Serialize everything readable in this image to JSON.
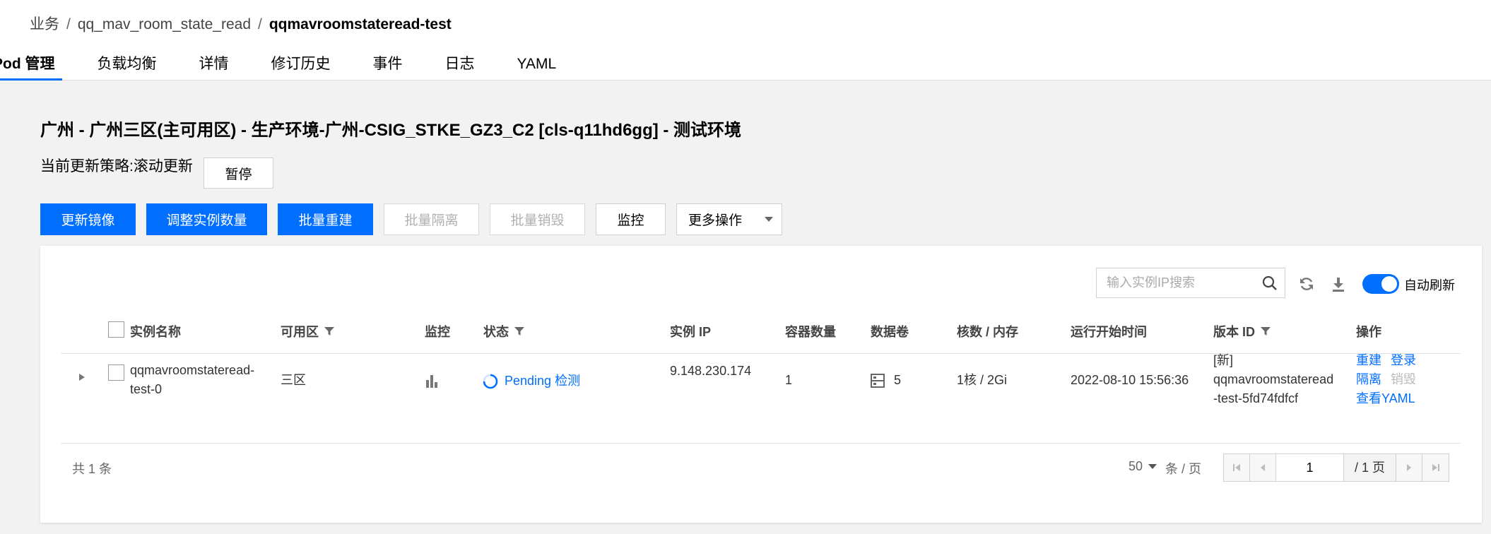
{
  "breadcrumb": {
    "item1": "业务",
    "item2": "qq_mav_room_state_read",
    "current": "qqmavroomstateread-test",
    "sep": "/"
  },
  "tabs": [
    {
      "label": "Pod 管理",
      "active": true
    },
    {
      "label": "负载均衡"
    },
    {
      "label": "详情"
    },
    {
      "label": "修订历史"
    },
    {
      "label": "事件"
    },
    {
      "label": "日志"
    },
    {
      "label": "YAML"
    }
  ],
  "cluster_title": "广州 - 广州三区(主可用区) - 生产环境-广州-CSIG_STKE_GZ3_C2 [cls-q11hd6gg] - 测试环境",
  "strategy": {
    "label": "当前更新策略:滚动更新",
    "pause_button": "暂停"
  },
  "actions": {
    "update_image": "更新镜像",
    "adjust_instances": "调整实例数量",
    "batch_rebuild": "批量重建",
    "batch_isolate": "批量隔离",
    "batch_destroy": "批量销毁",
    "monitor": "监控",
    "more": "更多操作"
  },
  "search": {
    "placeholder": "输入实例IP搜索"
  },
  "auto_refresh": {
    "label": "自动刷新",
    "on": true
  },
  "table": {
    "headers": {
      "name": "实例名称",
      "zone": "可用区",
      "monitor": "监控",
      "status": "状态",
      "ip": "实例 IP",
      "containers": "容器数量",
      "volumes": "数据卷",
      "cpu_mem": "核数 / 内存",
      "start_time": "运行开始时间",
      "version": "版本 ID",
      "ops": "操作"
    },
    "rows": [
      {
        "name_line1": "qqmavroomstateread-",
        "name_line2": "test-0",
        "zone": "三区",
        "status": "Pending",
        "status_action": "检测",
        "ip": "9.148.230.174",
        "containers": "1",
        "volumes": "5",
        "cpu_mem": "1核 / 2Gi",
        "start_time": "2022-08-10 15:56:36",
        "version_line1": "[新]",
        "version_line2": "qqmavroomstateread",
        "version_line3": "-test-5fd74fdfcf",
        "op_rebuild": "重建",
        "op_login": "登录",
        "op_isolate": "隔离",
        "op_destroy": "销毁",
        "op_yaml": "查看YAML"
      }
    ]
  },
  "footer": {
    "total": "共 1 条",
    "page_size": "50",
    "page_size_unit": "条 / 页",
    "current_page": "1",
    "total_pages": "/ 1 页"
  },
  "colors": {
    "primary": "#006eff",
    "disabled_text": "#b0b0b0",
    "background": "#f2f2f2"
  }
}
